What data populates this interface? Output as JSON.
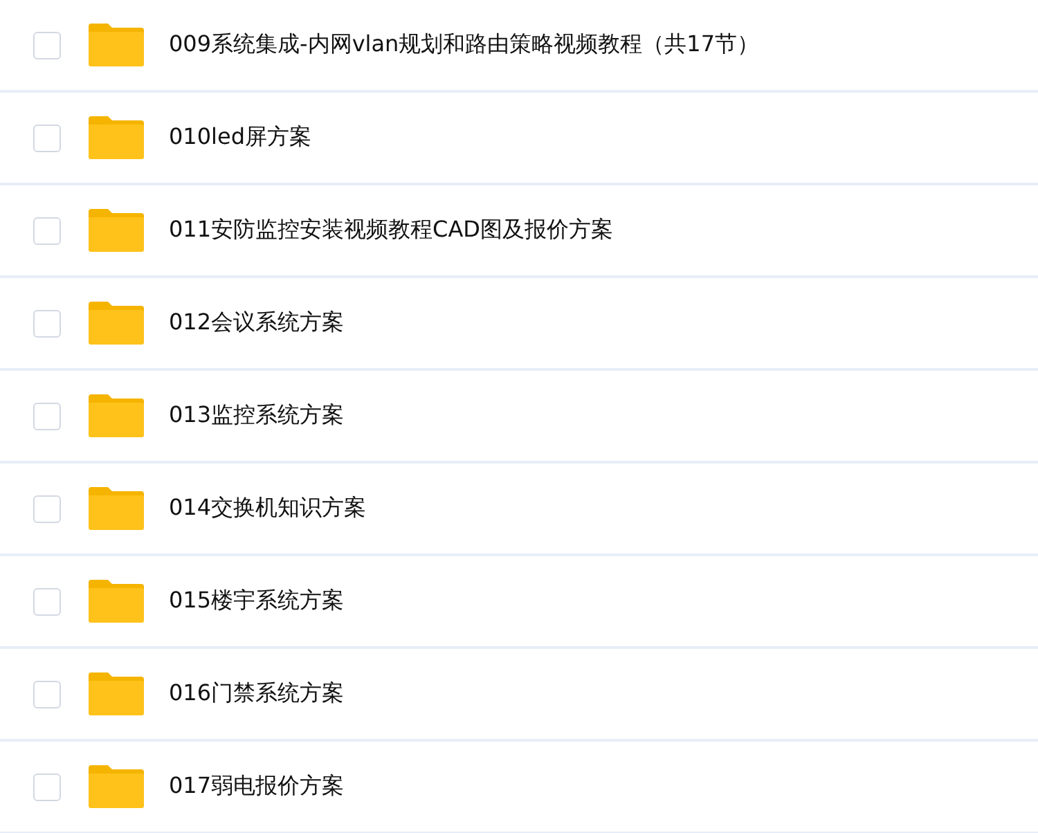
{
  "files": [
    {
      "name": "009系统集成-内网vlan规划和路由策略视频教程（共17节）",
      "checked": false
    },
    {
      "name": "010led屏方案",
      "checked": false
    },
    {
      "name": "011安防监控安装视频教程CAD图及报价方案",
      "checked": false
    },
    {
      "name": "012会议系统方案",
      "checked": false
    },
    {
      "name": "013监控系统方案",
      "checked": false
    },
    {
      "name": "014交换机知识方案",
      "checked": false
    },
    {
      "name": "015楼宇系统方案",
      "checked": false
    },
    {
      "name": "016门禁系统方案",
      "checked": false
    },
    {
      "name": "017弱电报价方案",
      "checked": false
    }
  ]
}
